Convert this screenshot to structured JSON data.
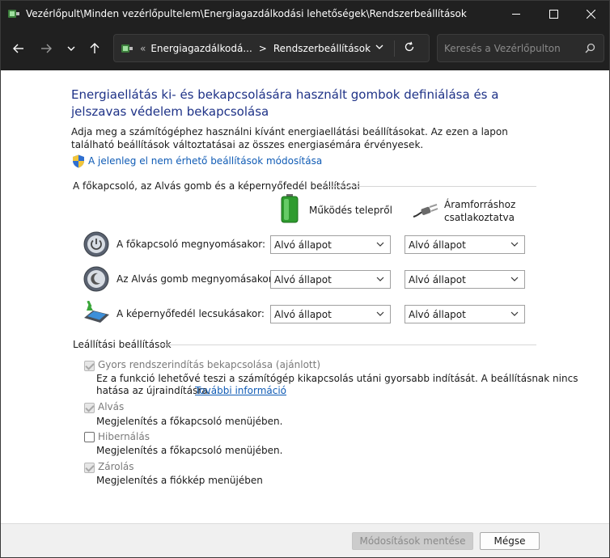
{
  "window": {
    "title": "Vezérlőpult\\Minden vezérlőpultelem\\Energiagazdálkodási lehetőségek\\Rendszerbeállítások"
  },
  "nav": {
    "breadcrumb_chevron": "«",
    "breadcrumbs": [
      "Energiagazdálkodá...",
      "Rendszerbeállítások"
    ],
    "breadcrumb_separator": ">",
    "search_placeholder": "Keresés a Vezérlőpulton"
  },
  "page": {
    "heading": "Energiaellátás ki- és bekapcsolására használt gombok definiálása és a jelszavas védelem bekapcsolása",
    "description": "Adja meg a számítógéphez használni kívánt energiaellátási beállításokat. Az ezen a lapon található beállítások változtatásai az összes energiasémára érvényesek.",
    "change_link": "A jelenleg el nem érhető beállítások módosítása",
    "buttons_section": {
      "title": "A főkapcsoló, az Alvás gomb és a képernyőfedél beállításai",
      "col_battery": "Működés telepről",
      "col_plugged_line1": "Áramforráshoz",
      "col_plugged_line2": "csatlakoztatva",
      "rows": [
        {
          "label": "A főkapcsoló megnyomásakor:",
          "battery": "Alvó állapot",
          "plugged": "Alvó állapot"
        },
        {
          "label": "Az Alvás gomb megnyomásakor:",
          "battery": "Alvó állapot",
          "plugged": "Alvó állapot"
        },
        {
          "label": "A képernyőfedél lecsukásakor:",
          "battery": "Alvó állapot",
          "plugged": "Alvó állapot"
        }
      ]
    },
    "shutdown_section": {
      "title": "Leállítási beállítások",
      "fast_startup": {
        "label": "Gyors rendszerindítás bekapcsolása (ajánlott)",
        "checked": true,
        "desc_line1": "Ez a funkció lehetővé teszi a számítógép kikapcsolás utáni gyorsabb indítását. A beállításnak nincs",
        "desc_line2_prefix": "hatása az újraindításra.",
        "more_info_link": "További információ"
      },
      "sleep": {
        "label": "Alvás",
        "checked": true,
        "desc": "Megjelenítés a főkapcsoló menüjében."
      },
      "hibernate": {
        "label": "Hibernálás",
        "checked": false,
        "desc": "Megjelenítés a főkapcsoló menüjében."
      },
      "lock": {
        "label": "Zárolás",
        "checked": true,
        "desc": "Megjelenítés a fiókkép menüjében"
      }
    }
  },
  "footer": {
    "save_label": "Módosítások mentése",
    "cancel_label": "Mégse"
  },
  "colors": {
    "heading": "#1e3287",
    "link": "#0f5bb5",
    "titlebar_bg": "#202020"
  }
}
